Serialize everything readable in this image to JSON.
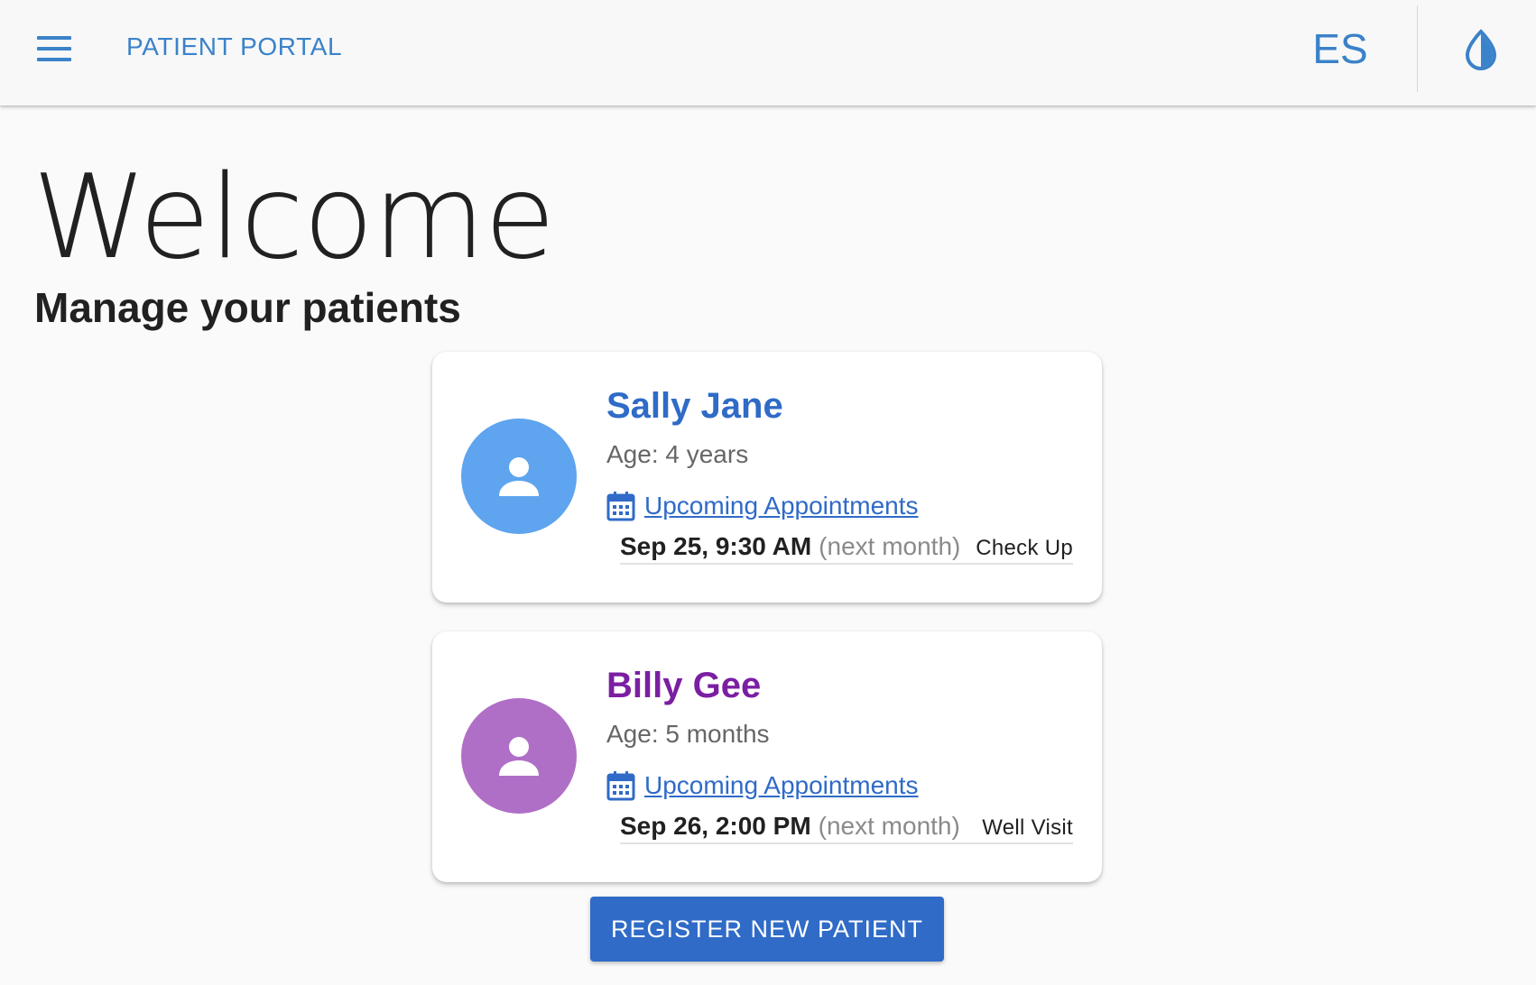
{
  "header": {
    "title": "PATIENT PORTAL",
    "language_label": "ES",
    "menu_icon": "hamburger-menu-icon",
    "theme_icon": "contrast-drop-icon",
    "accent_color": "#3a82c9"
  },
  "main": {
    "heading": "Welcome",
    "subheading": "Manage your patients"
  },
  "patients": [
    {
      "name": "Sally Jane",
      "name_color": "#2f6bc7",
      "avatar_color": "#5ea4ee",
      "age": "Age: 4 years",
      "appointments_link": "Upcoming Appointments",
      "appointment": {
        "date": "Sep 25, 9:30 AM",
        "relative": "(next month)",
        "type": "Check Up"
      }
    },
    {
      "name": "Billy Gee",
      "name_color": "#7b1fa2",
      "avatar_color": "#b06fc6",
      "age": "Age: 5 months",
      "appointments_link": "Upcoming Appointments",
      "appointment": {
        "date": "Sep 26, 2:00 PM",
        "relative": "(next month)",
        "type": "Well Visit"
      }
    }
  ],
  "actions": {
    "register_label": "REGISTER NEW PATIENT",
    "button_color": "#2f6bc7"
  }
}
